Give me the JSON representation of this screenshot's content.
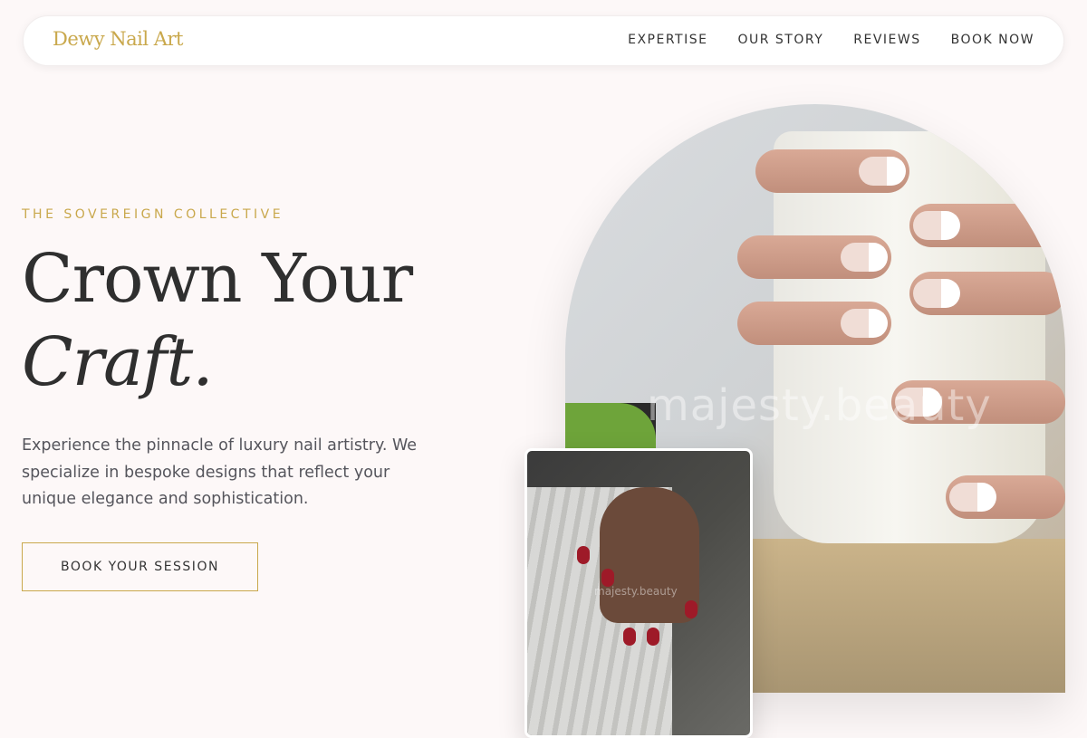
{
  "brand": {
    "logo_text": "Dewy Nail Art",
    "accent_color": "#c9a84c"
  },
  "nav": {
    "items": [
      "EXPERTISE",
      "OUR STORY",
      "REVIEWS",
      "BOOK NOW"
    ]
  },
  "hero": {
    "eyebrow": "THE SOVEREIGN COLLECTIVE",
    "headline_line1": "Crown Your",
    "headline_line2": "Craft.",
    "lead": "Experience the pinnacle of luxury nail artistry. We specialize in bespoke designs that reflect your unique elegance and sophistication.",
    "cta_label": "BOOK YOUR SESSION"
  },
  "images": {
    "main_watermark": "majesty.beauty",
    "secondary_watermark": "majesty.beauty"
  }
}
